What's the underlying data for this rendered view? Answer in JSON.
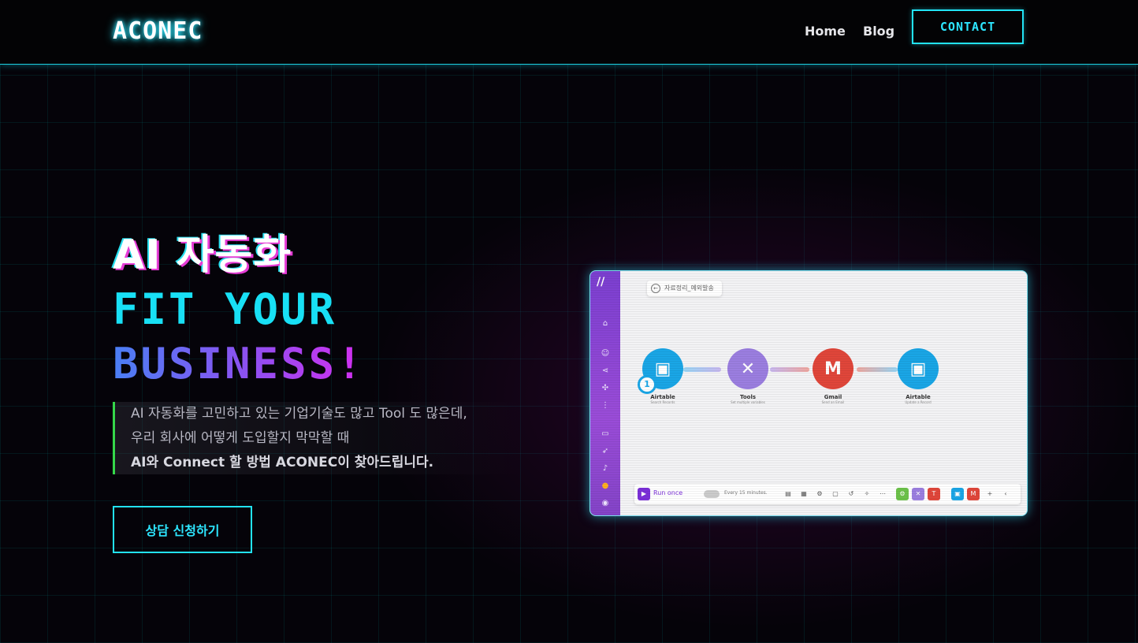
{
  "header": {
    "logo": "ACONEC",
    "nav": [
      {
        "label": "Home"
      },
      {
        "label": "Blog"
      }
    ],
    "contact_label": "CONTACT"
  },
  "hero": {
    "line1": "AI 자동화",
    "line2": "FIT YOUR",
    "line3": "BUSINESS!",
    "desc": [
      "AI 자동화를 고민하고 있는 기업기술도 많고 Tool 도 많은데,",
      "우리 회사에 어떻게 도입할지 막막할 때",
      "AI와 Connect 할 방법 ACONEC이 찾아드립니다."
    ],
    "cta_label": "상담 신청하기"
  },
  "screenshot": {
    "scenario_title": "자료정리_예외발송",
    "badge": "1",
    "nodes": [
      {
        "name": "Airtable",
        "sub": "Search Records",
        "color": "#1aa6e6",
        "icon": "box-icon"
      },
      {
        "name": "Tools",
        "sub": "Set multiple variables",
        "color": "#9b7ee0",
        "icon": "tools-icon"
      },
      {
        "name": "Gmail",
        "sub": "Send an Email",
        "color": "#e0463a",
        "icon": "gmail-icon"
      },
      {
        "name": "Airtable",
        "sub": "Update a Record",
        "color": "#1aa6e6",
        "icon": "box-icon"
      }
    ],
    "run_label": "Run once",
    "schedule": "Every 15 minutes."
  },
  "colors": {
    "accent_cyan": "#22e3f5",
    "accent_green": "#35d84a",
    "gradient_blue": "#4a7ff5",
    "gradient_magenta": "#d42ef0"
  }
}
